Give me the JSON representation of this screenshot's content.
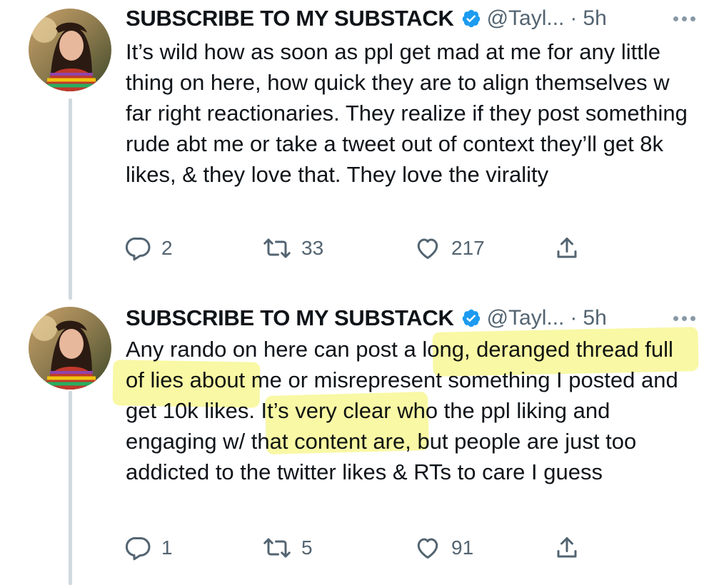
{
  "tweets": [
    {
      "author": {
        "display_name": "SUBSCRIBE TO MY SUBSTACK",
        "handle": "@Tayl...",
        "verified": true
      },
      "separator": "·",
      "time": "5h",
      "text": "It’s wild how as soon as ppl get mad at me for any little thing on here, how quick they are to align themselves w far right reactionaries. They realize if they post something rude abt me or take a tweet out of context they’ll get 8k likes, & they love that. They love the virality",
      "actions": {
        "replies": "2",
        "retweets": "33",
        "likes": "217"
      }
    },
    {
      "author": {
        "display_name": "SUBSCRIBE TO MY SUBSTACK",
        "handle": "@Tayl...",
        "verified": true
      },
      "separator": "·",
      "time": "5h",
      "text": "Any rando on here can post a long, deranged thread full of lies about me or misrepresent something I posted and get 10k likes. It’s very clear who the ppl liking and engaging w/ that content are, but people are just too addicted to the twitter likes & RTs to care I guess",
      "actions": {
        "replies": "1",
        "retweets": "5",
        "likes": "91"
      }
    }
  ],
  "colors": {
    "text": "#0f1419",
    "secondary": "#536471",
    "verified_badge": "#1d9bf0",
    "thread_line": "#cfd9de",
    "highlighter": "#f6f46e"
  },
  "icons": {
    "reply": "reply-icon",
    "retweet": "retweet-icon",
    "like": "heart-icon",
    "share": "share-icon",
    "more": "more-icon",
    "verified": "verified-badge-icon"
  }
}
